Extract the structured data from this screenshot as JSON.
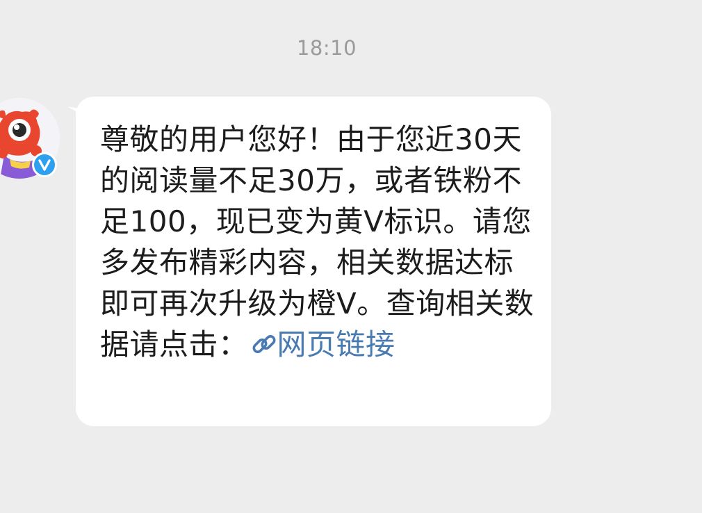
{
  "chat": {
    "timestamp": "18:10",
    "message": {
      "text": "尊敬的用户您好！由于您近30天的阅读量不足30万，或者铁粉不足100，现已变为黄V标识。请您多发布精彩内容，相关数据达标即可再次升级为橙V。查询相关数据请点击：",
      "link_icon": "link-icon",
      "link_text": "网页链接",
      "link_color": "#4a7ab2"
    },
    "sender": {
      "avatar_icon": "mascot-avatar",
      "badge_icon": "verified-v-badge",
      "badge_color": "#2f9ff0"
    }
  }
}
